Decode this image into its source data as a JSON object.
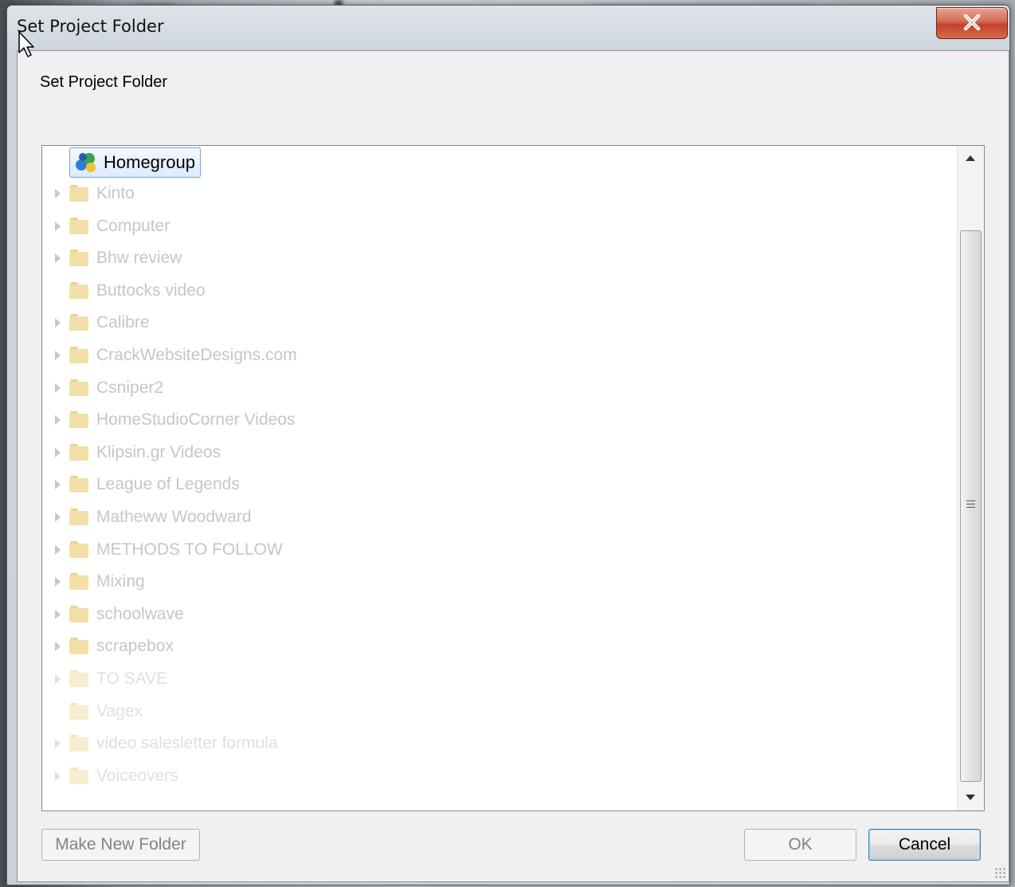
{
  "window": {
    "title": "Set Project Folder",
    "close_icon": "close-icon"
  },
  "dialog": {
    "instruction": "Set Project Folder"
  },
  "tree": {
    "selected": {
      "label": "Homegroup",
      "icon": "homegroup-icon"
    },
    "items": [
      {
        "label": "Kinto",
        "icon": "user-folder-icon"
      },
      {
        "label": "Computer",
        "icon": "computer-icon"
      },
      {
        "label": "Bhw review",
        "icon": "folder-icon"
      },
      {
        "label": "Buttocks video",
        "icon": "folder-icon"
      },
      {
        "label": "Calibre",
        "icon": "folder-icon"
      },
      {
        "label": "CrackWebsiteDesigns.com",
        "icon": "folder-icon"
      },
      {
        "label": "Csniper2",
        "icon": "folder-icon"
      },
      {
        "label": "HomeStudioCorner Videos",
        "icon": "folder-icon"
      },
      {
        "label": "Klipsin.gr Videos",
        "icon": "folder-icon"
      },
      {
        "label": "League of Legends",
        "icon": "folder-icon"
      },
      {
        "label": "Matheww Woodward",
        "icon": "folder-icon"
      },
      {
        "label": "METHODS TO FOLLOW",
        "icon": "folder-icon"
      },
      {
        "label": "Mixing",
        "icon": "folder-icon"
      },
      {
        "label": "schoolwave",
        "icon": "folder-icon"
      },
      {
        "label": "scrapebox",
        "icon": "folder-icon"
      },
      {
        "label": "TO SAVE",
        "icon": "folder-icon"
      },
      {
        "label": "Vagex",
        "icon": "folder-icon"
      },
      {
        "label": "video salesletter formula",
        "icon": "folder-icon"
      },
      {
        "label": "Voiceovers",
        "icon": "folder-icon"
      }
    ]
  },
  "buttons": {
    "make_new_folder": "Make New Folder",
    "ok": "OK",
    "cancel": "Cancel"
  }
}
